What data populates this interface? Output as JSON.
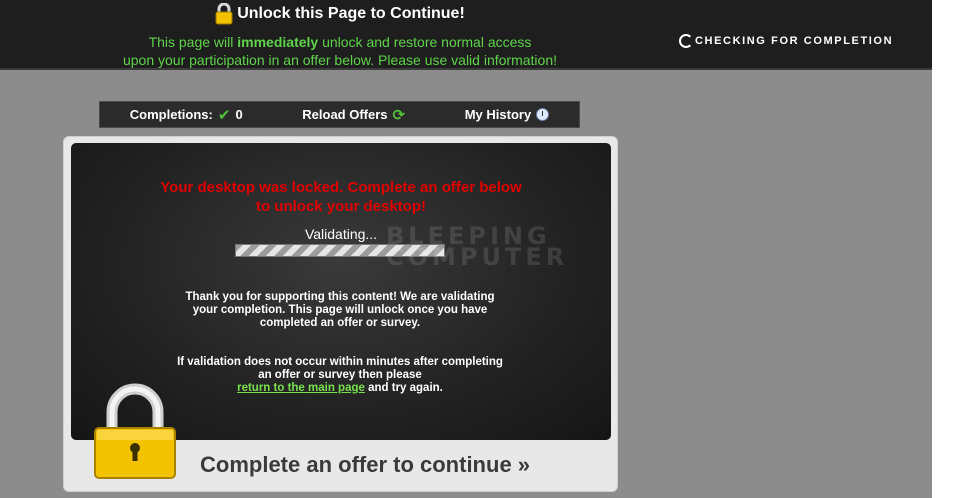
{
  "header": {
    "title": "Unlock this Page to Continue!",
    "subtitle_pre": "This page will ",
    "subtitle_bold": "immediately",
    "subtitle_post": " unlock and restore normal access",
    "subtitle_line2": "upon your participation in an offer below. Please use valid information!",
    "checking": "CHECKING FOR COMPLETION"
  },
  "nav": {
    "completions_label": "Completions:",
    "completions_count": "0",
    "reload_label": "Reload Offers",
    "history_label": "My History"
  },
  "panel": {
    "alert_line1": "Your desktop was locked. Complete an offer below",
    "alert_line2": "to unlock your desktop!",
    "validating": "Validating...",
    "watermark_line1": "BLEEPING",
    "watermark_line2": "COMPUTER",
    "thanks_text": "Thank you for supporting this content! We are validating your completion. This page will unlock once you have completed an offer or survey.",
    "validation_pre": "If validation does not occur within minutes after completing an offer or survey then please",
    "validation_link": "return to the main page",
    "validation_post": " and try again.",
    "cta": "Complete an offer to continue »"
  },
  "colors": {
    "accent_green": "#5fd34a",
    "alert_red": "#e00000",
    "link_green": "#77e04d"
  },
  "icons": {
    "title": "padlock-icon",
    "checking": "spinner-icon",
    "completions": "checkmark-icon",
    "reload": "reload-icon",
    "history": "clock-icon",
    "panel": "padlock-icon"
  }
}
